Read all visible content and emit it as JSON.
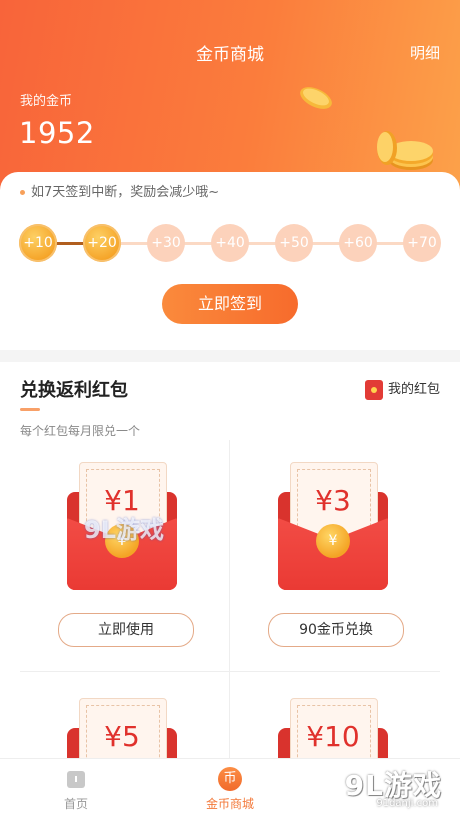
{
  "header": {
    "title": "金币商城",
    "detail_link": "明细",
    "coins_label": "我的金币",
    "coins_value": "1952"
  },
  "signin": {
    "notice": "如7天签到中断，奖励会减少哦~",
    "steps": [
      "+10",
      "+20",
      "+30",
      "+40",
      "+50",
      "+60",
      "+70"
    ],
    "completed_steps": 2,
    "button_label": "立即签到"
  },
  "exchange": {
    "title": "兑换返利红包",
    "subtitle": "每个红包每月限兑一个",
    "my_packets_label": "我的红包",
    "items": [
      {
        "amount": "¥1",
        "button": "立即使用"
      },
      {
        "amount": "¥3",
        "button": "90金币兑换"
      },
      {
        "amount": "¥5",
        "button": ""
      },
      {
        "amount": "¥10",
        "button": ""
      }
    ],
    "coin_glyph": "¥"
  },
  "tabbar": {
    "home": "首页",
    "mall": "金币商城",
    "mall_icon_glyph": "币"
  },
  "watermark": {
    "brand": "9L游戏",
    "url": "91danji.com"
  },
  "colors": {
    "accent": "#f76b2c",
    "gold": "#f5a327",
    "red": "#e23b36"
  }
}
